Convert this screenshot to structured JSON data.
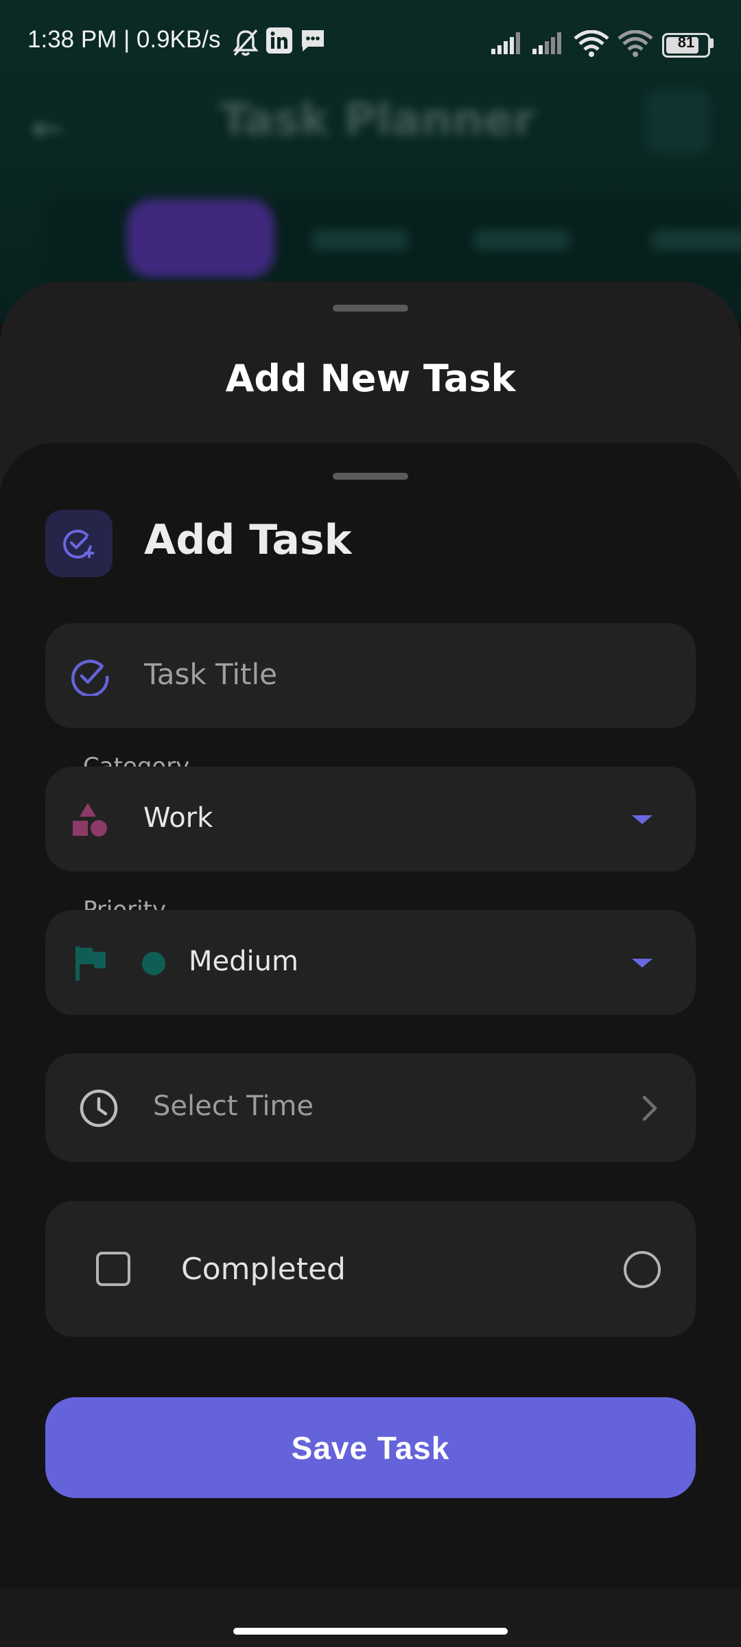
{
  "status_bar": {
    "time_speed": "1:38 PM | 0.9KB/s",
    "battery": "81"
  },
  "background_app": {
    "title": "Task Planner"
  },
  "sheet": {
    "title": "Add New Task"
  },
  "form": {
    "header_title": "Add Task",
    "task_title_placeholder": "Task Title",
    "category": {
      "label": "Category",
      "value": "Work"
    },
    "priority": {
      "label": "Priority",
      "value": "Medium"
    },
    "time_placeholder": "Select Time",
    "completed_label": "Completed",
    "save_label": "Save Task"
  },
  "colors": {
    "accent": "#6563da",
    "category_icon": "#8c3a66",
    "priority_icon": "#0f5e55"
  }
}
